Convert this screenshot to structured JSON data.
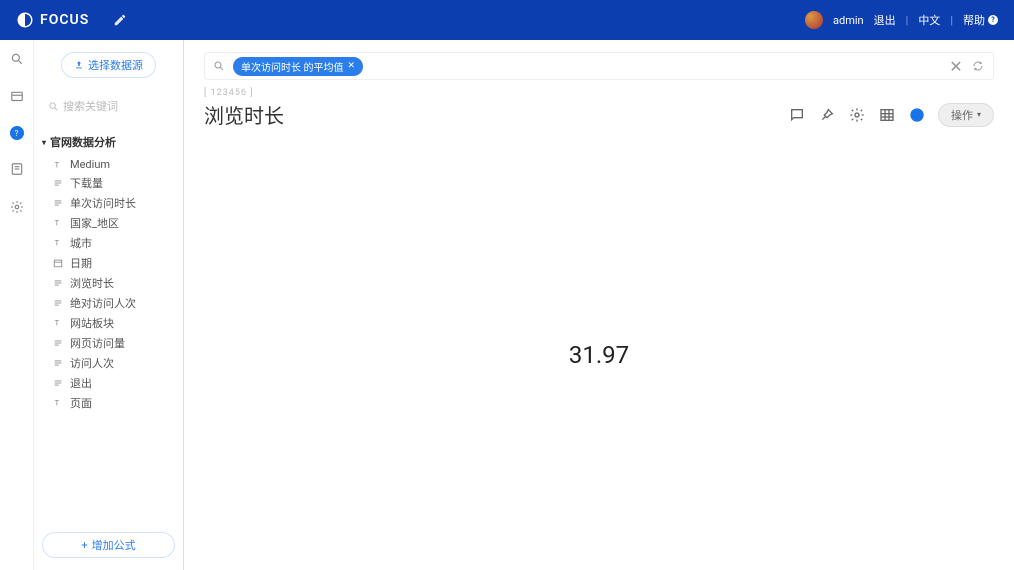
{
  "header": {
    "brand": "FOCUS",
    "user": "admin",
    "logout": "退出",
    "lang": "中文",
    "help": "帮助"
  },
  "sidebar": {
    "select_source": "选择数据源",
    "search_placeholder": "搜索关键词",
    "datasource": "官网数据分析",
    "fields": [
      {
        "type": "text",
        "label": "Medium"
      },
      {
        "type": "num",
        "label": "下载量"
      },
      {
        "type": "num",
        "label": "单次访问时长"
      },
      {
        "type": "text",
        "label": "国家_地区"
      },
      {
        "type": "text",
        "label": "城市"
      },
      {
        "type": "date",
        "label": "日期"
      },
      {
        "type": "num",
        "label": "浏览时长"
      },
      {
        "type": "num",
        "label": "绝对访问人次"
      },
      {
        "type": "text",
        "label": "网站板块"
      },
      {
        "type": "num",
        "label": "网页访问量"
      },
      {
        "type": "num",
        "label": "访问人次"
      },
      {
        "type": "num",
        "label": "退出"
      },
      {
        "type": "text",
        "label": "页面"
      }
    ],
    "add_formula": "增加公式"
  },
  "query": {
    "chip": "单次访问时长 的平均值"
  },
  "page": {
    "breadcrumb": "[ 123456 ]",
    "title": "浏览时长",
    "action_label": "操作"
  },
  "chart_data": {
    "type": "table",
    "title": "浏览时长",
    "value": 31.97
  }
}
